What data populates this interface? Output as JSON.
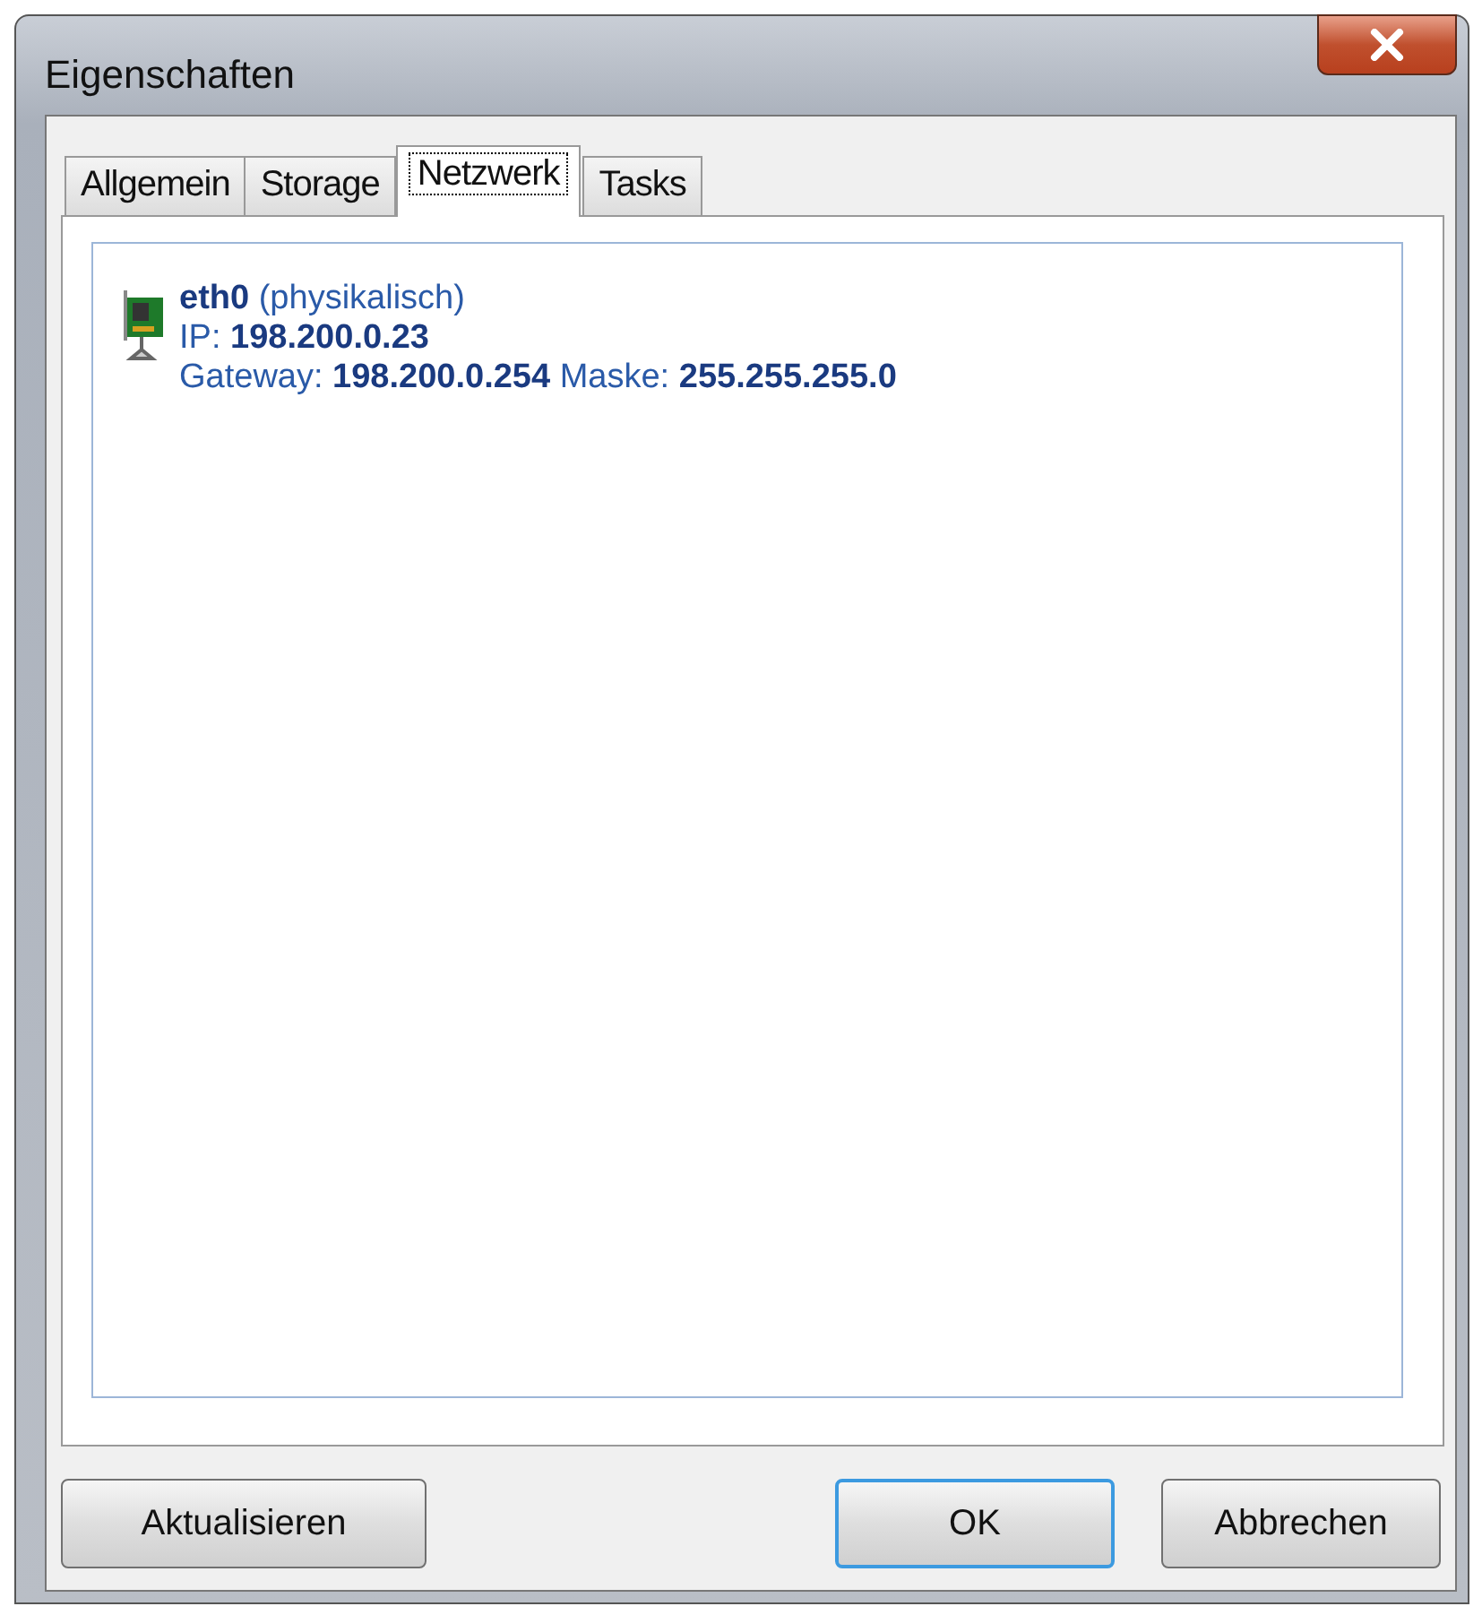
{
  "window": {
    "title": "Eigenschaften"
  },
  "tabs": [
    {
      "label": "Allgemein",
      "selected": false
    },
    {
      "label": "Storage",
      "selected": false
    },
    {
      "label": "Netzwerk",
      "selected": true
    },
    {
      "label": "Tasks",
      "selected": false
    }
  ],
  "interfaces": [
    {
      "name": "eth0",
      "type": "(physikalisch)",
      "ip_label": "IP:",
      "ip": "198.200.0.23",
      "gateway_label": "Gateway:",
      "gateway": "198.200.0.254",
      "mask_label": "Maske:",
      "mask": "255.255.255.0"
    }
  ],
  "buttons": [
    {
      "label": "Aktualisieren",
      "default": false
    },
    {
      "label": "OK",
      "default": true
    },
    {
      "label": "Abbrechen",
      "default": false
    }
  ]
}
